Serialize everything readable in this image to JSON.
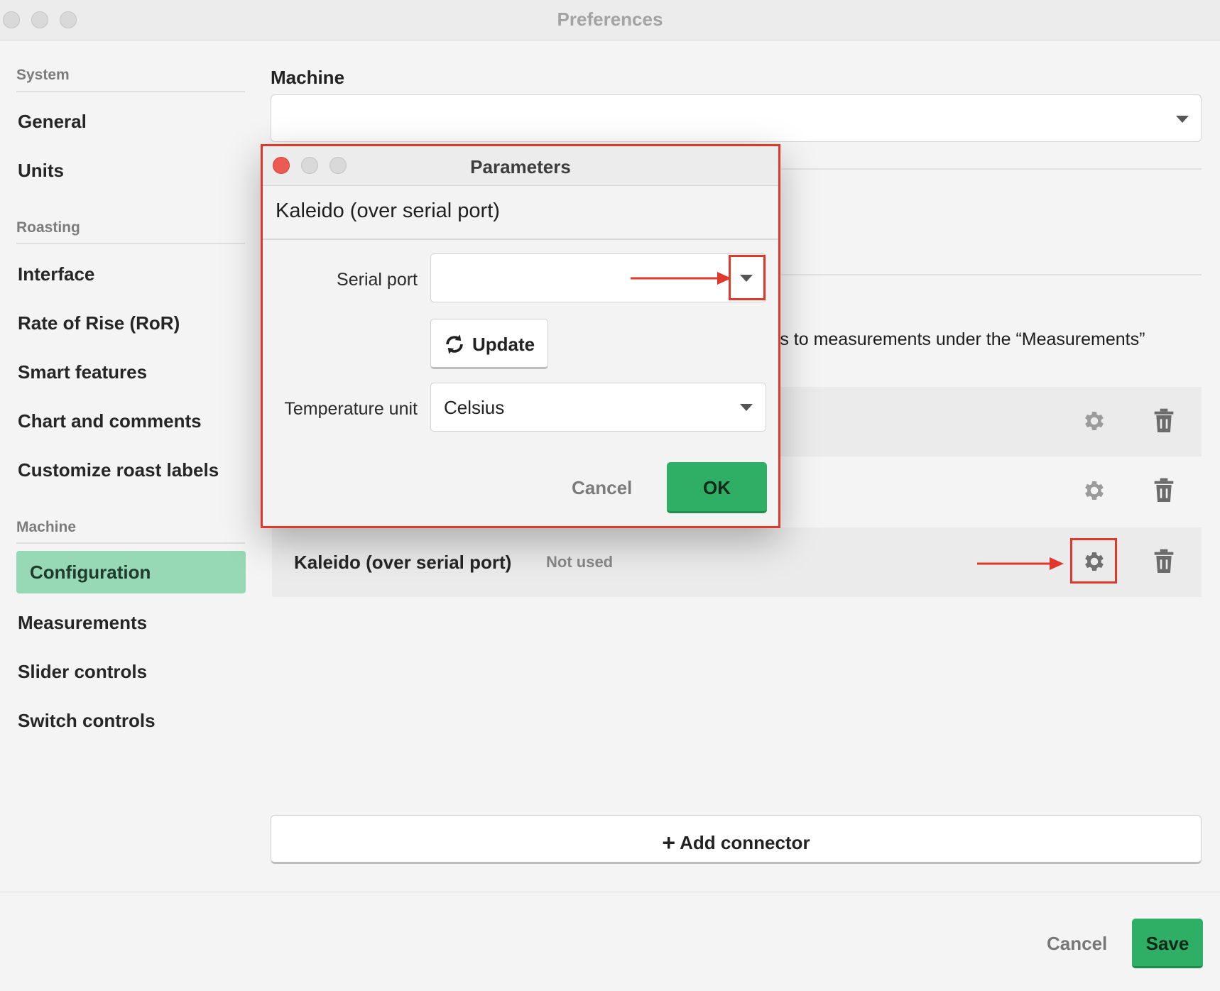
{
  "window": {
    "title": "Preferences"
  },
  "sidebar": {
    "sections": [
      {
        "label": "System",
        "items": [
          "General",
          "Units"
        ]
      },
      {
        "label": "Roasting",
        "items": [
          "Interface",
          "Rate of Rise (RoR)",
          "Smart features",
          "Chart and comments",
          "Customize roast labels"
        ]
      },
      {
        "label": "Machine",
        "items": [
          "Configuration",
          "Measurements",
          "Slider controls",
          "Switch controls"
        ]
      }
    ],
    "active_item": "Configuration"
  },
  "main": {
    "machine_label": "Machine",
    "machine_select_value": "",
    "description_fragment": "rs to measurements under the “Measurements”",
    "connectors": [
      {
        "name": "",
        "status": ""
      },
      {
        "name": "",
        "status": ""
      },
      {
        "name": "Kaleido (over serial port)",
        "status": "Not used"
      }
    ],
    "add_connector_label": "Add connector"
  },
  "footer": {
    "cancel_label": "Cancel",
    "save_label": "Save"
  },
  "dialog": {
    "title": "Parameters",
    "heading": "Kaleido (over serial port)",
    "serial_port_label": "Serial port",
    "serial_port_value": "",
    "update_label": "Update",
    "temperature_unit_label": "Temperature unit",
    "temperature_unit_value": "Celsius",
    "cancel_label": "Cancel",
    "ok_label": "OK"
  },
  "icons": {
    "gear": "gear-icon",
    "trash": "trash-icon",
    "refresh": "refresh-icon",
    "plus": "plus-icon",
    "caret": "chevron-down-icon",
    "annotation_arrow": "arrow-right-icon"
  },
  "colors": {
    "accent_green": "#2fae66",
    "active_nav": "#97d9b4",
    "annotation_red": "#e2382b"
  }
}
